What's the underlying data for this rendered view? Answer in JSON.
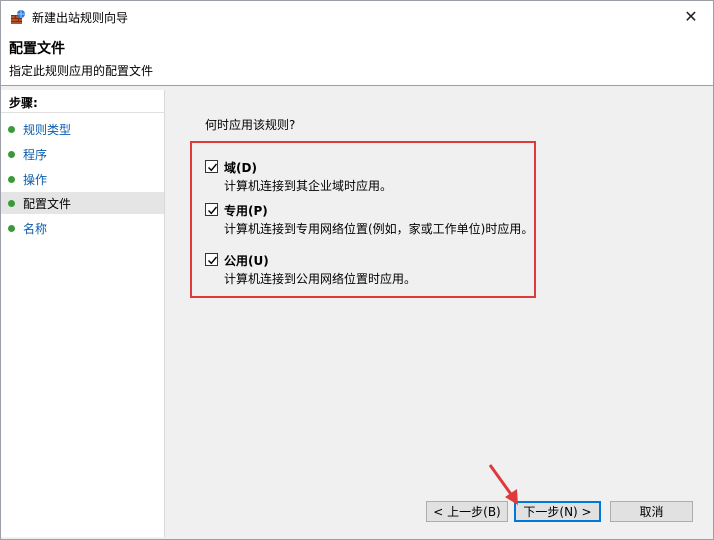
{
  "window": {
    "title": "新建出站规则向导",
    "close_glyph": "✕"
  },
  "header": {
    "title": "配置文件",
    "subtitle": "指定此规则应用的配置文件"
  },
  "steps": {
    "title": "步骤:",
    "items": [
      {
        "label": "规则类型"
      },
      {
        "label": "程序"
      },
      {
        "label": "操作"
      },
      {
        "label": "配置文件",
        "active": true
      },
      {
        "label": "名称"
      }
    ]
  },
  "main": {
    "question": "何时应用该规则?",
    "options": [
      {
        "label": "域(D)",
        "description": "计算机连接到其企业域时应用。",
        "checked": true
      },
      {
        "label": "专用(P)",
        "description": "计算机连接到专用网络位置(例如，家或工作单位)时应用。",
        "checked": true
      },
      {
        "label": "公用(U)",
        "description": "计算机连接到公用网络位置时应用。",
        "checked": true
      }
    ]
  },
  "buttons": {
    "back": "< 上一步(B)",
    "next": "下一步(N) >",
    "cancel": "取消"
  },
  "colors": {
    "highlight": "#e0393c",
    "step_dot": "#3a9a3a",
    "link": "#0b5cad",
    "primary_border": "#0078d7"
  }
}
